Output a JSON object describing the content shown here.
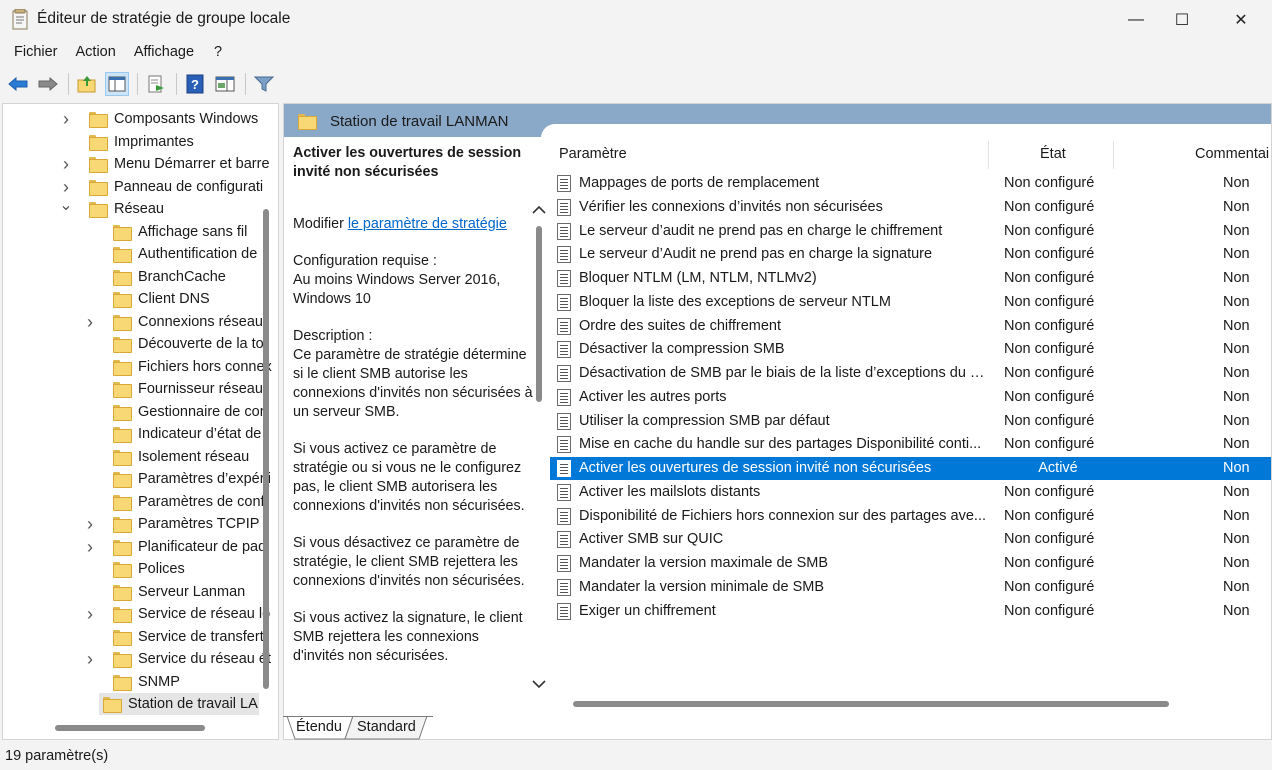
{
  "window": {
    "title": "Éditeur de stratégie de groupe locale",
    "minimize_glyph": "—",
    "maximize_glyph": "☐",
    "close_glyph": "✕"
  },
  "menu": [
    "Fichier",
    "Action",
    "Affichage",
    "?"
  ],
  "toolbar": {
    "icons": [
      "back-arrow-icon",
      "forward-arrow-icon",
      "up-folder-icon",
      "show-hide-tree-icon",
      "export-list-icon",
      "help-icon",
      "properties-pane-icon",
      "filter-icon"
    ]
  },
  "tree": {
    "items": [
      {
        "label": "Composants Windows",
        "expandable": true,
        "expanded": false,
        "level": 1
      },
      {
        "label": "Imprimantes",
        "expandable": false,
        "expanded": false,
        "level": 1
      },
      {
        "label": "Menu Démarrer et barre",
        "expandable": true,
        "expanded": false,
        "level": 1
      },
      {
        "label": "Panneau de configurati",
        "expandable": true,
        "expanded": false,
        "level": 1
      },
      {
        "label": "Réseau",
        "expandable": true,
        "expanded": true,
        "level": 1
      },
      {
        "label": "Affichage sans fil",
        "expandable": false,
        "expanded": false,
        "level": 2
      },
      {
        "label": "Authentification de",
        "expandable": false,
        "expanded": false,
        "level": 2
      },
      {
        "label": "BranchCache",
        "expandable": false,
        "expanded": false,
        "level": 2
      },
      {
        "label": "Client DNS",
        "expandable": false,
        "expanded": false,
        "level": 2
      },
      {
        "label": "Connexions réseau",
        "expandable": true,
        "expanded": false,
        "level": 2
      },
      {
        "label": "Découverte de la to",
        "expandable": false,
        "expanded": false,
        "level": 2
      },
      {
        "label": "Fichiers hors connex",
        "expandable": false,
        "expanded": false,
        "level": 2
      },
      {
        "label": "Fournisseur réseau",
        "expandable": false,
        "expanded": false,
        "level": 2
      },
      {
        "label": "Gestionnaire de cor",
        "expandable": false,
        "expanded": false,
        "level": 2
      },
      {
        "label": "Indicateur d’état de",
        "expandable": false,
        "expanded": false,
        "level": 2
      },
      {
        "label": "Isolement réseau",
        "expandable": false,
        "expanded": false,
        "level": 2
      },
      {
        "label": "Paramètres d’expérii",
        "expandable": false,
        "expanded": false,
        "level": 2
      },
      {
        "label": "Paramètres de confi",
        "expandable": false,
        "expanded": false,
        "level": 2
      },
      {
        "label": "Paramètres TCPIP",
        "expandable": true,
        "expanded": false,
        "level": 2
      },
      {
        "label": "Planificateur de paq",
        "expandable": true,
        "expanded": false,
        "level": 2
      },
      {
        "label": "Polices",
        "expandable": false,
        "expanded": false,
        "level": 2
      },
      {
        "label": "Serveur Lanman",
        "expandable": false,
        "expanded": false,
        "level": 2
      },
      {
        "label": "Service de réseau lo",
        "expandable": true,
        "expanded": false,
        "level": 2
      },
      {
        "label": "Service de transfert",
        "expandable": false,
        "expanded": false,
        "level": 2
      },
      {
        "label": "Service du réseau ét",
        "expandable": true,
        "expanded": false,
        "level": 2
      },
      {
        "label": "SNMP",
        "expandable": false,
        "expanded": false,
        "level": 2
      },
      {
        "label": "Station de travail LA",
        "expandable": false,
        "expanded": false,
        "level": 2,
        "selected": true
      }
    ]
  },
  "right": {
    "header_title": "Station de travail LANMAN",
    "description": {
      "title": "Activer les ouvertures de session invité non sécurisées",
      "edit_prefix": "Modifier ",
      "edit_link": "le paramètre de stratégie",
      "requirements_label": "Configuration requise :",
      "requirements": "Au moins Windows Server 2016, Windows 10",
      "description_label": "Description :",
      "para1": "Ce paramètre de stratégie détermine si le client SMB autorise les connexions d'invités non sécurisées à un serveur SMB.",
      "para2": "Si vous activez ce paramètre de stratégie ou si vous ne le configurez pas, le client SMB autorisera les connexions d'invités non sécurisées.",
      "para3": "Si vous désactivez ce paramètre de stratégie, le client SMB rejettera les connexions d'invités non sécurisées.",
      "para4": "Si vous activez la signature, le client SMB rejettera les connexions d'invités non sécurisées."
    },
    "columns": {
      "setting": "Paramètre",
      "state": "État",
      "comment": "Commentai"
    },
    "rows": [
      {
        "name": "Mappages de ports de remplacement",
        "state": "Non configuré",
        "comment": "Non"
      },
      {
        "name": "Vérifier les connexions d’invités non sécurisées",
        "state": "Non configuré",
        "comment": "Non"
      },
      {
        "name": "Le serveur d’audit ne prend pas en charge le chiffrement",
        "state": "Non configuré",
        "comment": "Non"
      },
      {
        "name": "Le serveur d’Audit ne prend pas en charge la signature",
        "state": "Non configuré",
        "comment": "Non"
      },
      {
        "name": "Bloquer NTLM (LM, NTLM, NTLMv2)",
        "state": "Non configuré",
        "comment": "Non"
      },
      {
        "name": "Bloquer la liste des exceptions de serveur NTLM",
        "state": "Non configuré",
        "comment": "Non"
      },
      {
        "name": "Ordre des suites de chiffrement",
        "state": "Non configuré",
        "comment": "Non"
      },
      {
        "name": "Désactiver la compression SMB",
        "state": "Non configuré",
        "comment": "Non"
      },
      {
        "name": "Désactivation de SMB par le biais de la liste d’exceptions du s...",
        "state": "Non configuré",
        "comment": "Non"
      },
      {
        "name": "Activer les autres ports",
        "state": "Non configuré",
        "comment": "Non"
      },
      {
        "name": "Utiliser la compression SMB par défaut",
        "state": "Non configuré",
        "comment": "Non"
      },
      {
        "name": "Mise en cache du handle sur des partages Disponibilité conti...",
        "state": "Non configuré",
        "comment": "Non"
      },
      {
        "name": "Activer les ouvertures de session invité non sécurisées",
        "state": "Activé",
        "comment": "Non",
        "selected": true
      },
      {
        "name": "Activer les mailslots distants",
        "state": "Non configuré",
        "comment": "Non"
      },
      {
        "name": "Disponibilité de Fichiers hors connexion sur des partages ave...",
        "state": "Non configuré",
        "comment": "Non"
      },
      {
        "name": "Activer SMB sur QUIC",
        "state": "Non configuré",
        "comment": "Non"
      },
      {
        "name": "Mandater la version maximale de SMB",
        "state": "Non configuré",
        "comment": "Non"
      },
      {
        "name": "Mandater la version minimale de SMB",
        "state": "Non configuré",
        "comment": "Non"
      },
      {
        "name": "Exiger un chiffrement",
        "state": "Non configuré",
        "comment": "Non"
      }
    ]
  },
  "tabs": [
    "Étendu",
    "Standard"
  ],
  "status": "19 paramètre(s)",
  "colors": {
    "selection": "#0078d7",
    "header": "#8aa8c8",
    "link": "#0066cc"
  }
}
